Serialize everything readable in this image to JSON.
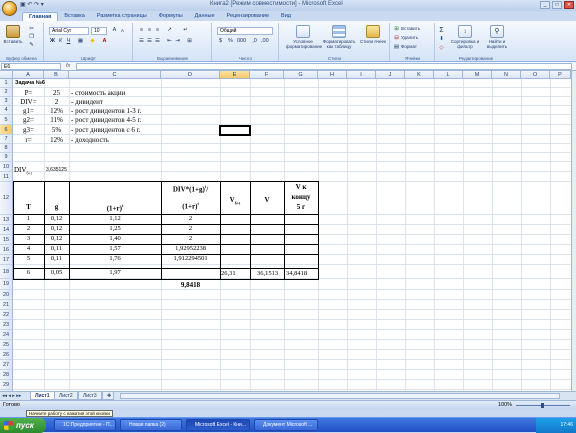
{
  "window": {
    "title": "Книга2  [Режим совместимости] - Microsoft Excel",
    "qat": "▣ ↶ ↷ ▾"
  },
  "tabs": [
    "Главная",
    "Вставка",
    "Разметка страницы",
    "Формулы",
    "Данные",
    "Рецензирование",
    "Вид"
  ],
  "ribbon": {
    "paste": "Вставить",
    "clipboard": "Буфер обмена",
    "font_name": "Arial Cyr",
    "font_size": "10",
    "font": "Шрифт",
    "alignment": "Выравнивание",
    "number_format": "Общий",
    "number": "Число",
    "cond_format": "Условное форматирование",
    "format_table": "Форматировать как таблицу",
    "cell_styles": "Стили ячеек",
    "styles": "Стили",
    "insert": "Вставить",
    "delete": "Удалить",
    "format": "Формат",
    "cells": "Ячейки",
    "sort": "Сортировка и фильтр",
    "find": "Найти и выделить",
    "editing": "Редактирование",
    "sum_icon": "Σ"
  },
  "formula_bar": {
    "name_box": "E6",
    "fx": "fx",
    "value": ""
  },
  "columns": [
    "A",
    "B",
    "C",
    "D",
    "E",
    "F",
    "G",
    "H",
    "I",
    "J",
    "K",
    "L",
    "M",
    "N",
    "O",
    "P"
  ],
  "rows": [
    "1",
    "2",
    "3",
    "4",
    "5",
    "6",
    "7",
    "8",
    "9",
    "10",
    "11",
    "12",
    "13",
    "14",
    "15",
    "16",
    "17",
    "18",
    "19",
    "20",
    "21",
    "22",
    "23",
    "24",
    "25",
    "26",
    "27",
    "28",
    "29",
    "30",
    "31",
    "32",
    "33",
    "34",
    "35",
    "36"
  ],
  "cells": {
    "a1": "Задача №6",
    "a2": "P=",
    "b2": "25",
    "c2": "- стоимость акции",
    "a3": "DIV=",
    "b3": "2",
    "c3": "- дивидент",
    "a4": "g1=",
    "b4": "12%",
    "c4": "- рост дивидентов 1-3 г.",
    "a5": "g2=",
    "b5": "11%",
    "c5": "- рост дивидентов 4-5 г.",
    "a6": "g3=",
    "b6": "5%",
    "c6": "- рост дивидентов с 6 г.",
    "a7": "r=",
    "b7": "12%",
    "c7": "- доходность",
    "a10": "DIV",
    "a10sub": "6+t",
    "b10": "3,635125",
    "h_t": "T",
    "h_g": "g",
    "h_c": "(1+r)",
    "h_c_sup": "t",
    "h_d1": "DIV*(1+g)",
    "h_d1_sup": "t",
    "h_d2": "(1+r)",
    "h_d2_sup": "t",
    "h_e": "V",
    "h_e_sub": "6+t",
    "h_f": "V",
    "h_g1": "V к",
    "h_g2": "концу",
    "h_g3": "5 г",
    "table_rows": [
      {
        "t": "1",
        "g": "0,12",
        "c": "1,12",
        "d": "2"
      },
      {
        "t": "2",
        "g": "0,12",
        "c": "1,25",
        "d": "2"
      },
      {
        "t": "3",
        "g": "0,12",
        "c": "1,40",
        "d": "2"
      },
      {
        "t": "4",
        "g": "0,11",
        "c": "1,57",
        "d": "1,92952238"
      },
      {
        "t": "5",
        "g": "0,11",
        "c": "1,76",
        "d": "1,912294501"
      },
      {
        "t": "6",
        "g": "0,05",
        "c": "1,97",
        "d": ""
      }
    ],
    "e18": "26,31",
    "f18": "36,1513",
    "g18": "34,8418",
    "d19": "9,8418"
  },
  "sheet_tabs": [
    "Лист1",
    "Лист2",
    "Лист3"
  ],
  "status": {
    "ready": "Готово",
    "zoom": "100%"
  },
  "tooltip": "Начните работу с нажатия этой кнопки",
  "taskbar": {
    "start": "пуск",
    "items": [
      "1С:Предприятие - П...",
      "Новая папка (2)",
      "Microsoft Excel - Кни...",
      "Документ Microsoft ..."
    ],
    "clock": "17:46"
  }
}
